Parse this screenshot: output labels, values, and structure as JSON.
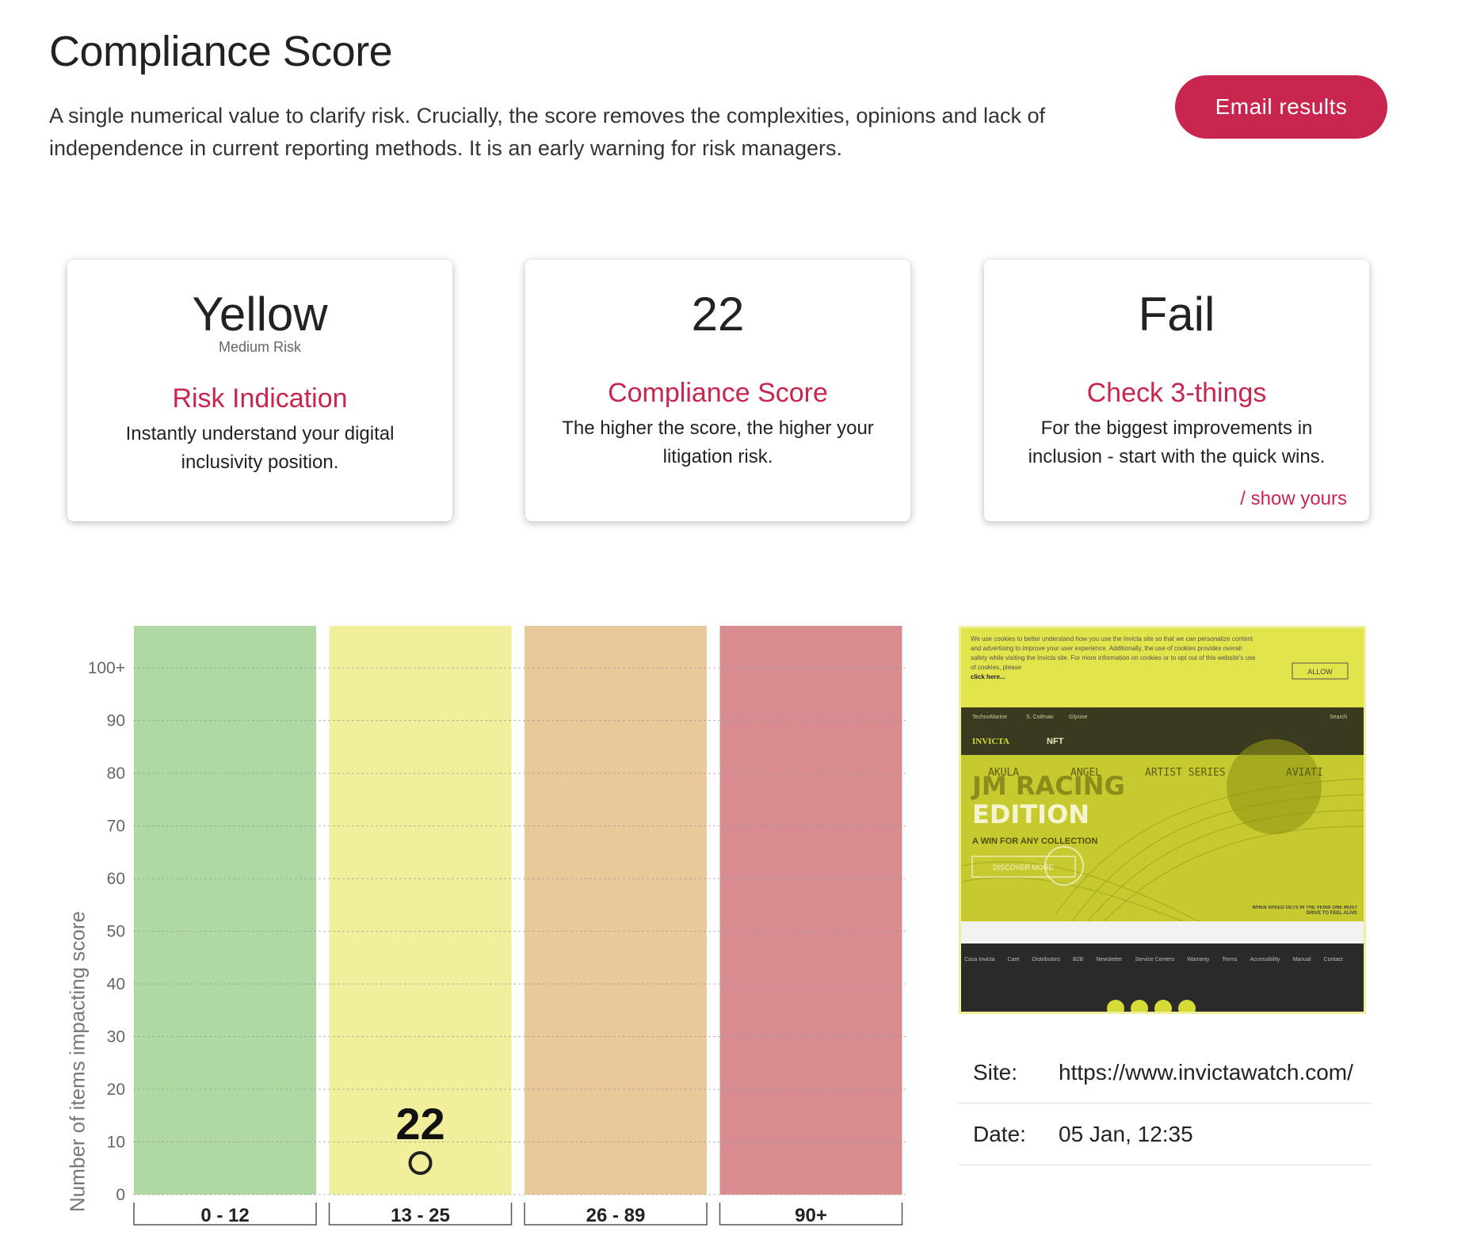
{
  "header": {
    "title": "Compliance Score",
    "description": "A single numerical value to clarify risk. Crucially, the score removes the complexities, opinions and lack of independence in current reporting methods. It is an early warning for risk managers.",
    "email_button": "Email results"
  },
  "cards": [
    {
      "big": "Yellow",
      "sub": "Medium Risk",
      "heading": "Risk Indication",
      "body": "Instantly understand your digital inclusivity position."
    },
    {
      "big": "22",
      "heading": "Compliance Score",
      "body": "The higher the score, the higher your litigation risk."
    },
    {
      "big": "Fail",
      "heading": "Check 3-things",
      "body": "For the biggest improvements in inclusion - start with the quick wins.",
      "link": "/ show yours"
    }
  ],
  "chart_data": {
    "type": "bar",
    "ylabel": "Number of items impacting score",
    "y_ticks": [
      "0",
      "10",
      "20",
      "30",
      "40",
      "50",
      "60",
      "70",
      "80",
      "90",
      "100+"
    ],
    "ylim": [
      0,
      108
    ],
    "categories": [
      "0 - 12",
      "13 - 25",
      "26 - 89",
      "90+"
    ],
    "band_colors": [
      "#afd8a3",
      "#f1ef9b",
      "#e9c99a",
      "#d98c90"
    ],
    "marker": {
      "category": "13 - 25",
      "label": "22",
      "y": 6
    },
    "grid": true
  },
  "screenshot_preview": {
    "cookie_text": "We use cookies to better understand how you use the Invicta site so that we can personalize content and advertising to improve your user experience. Additionally, the use of cookies provides overall safety while visiting the Invicta site. For more information on cookies or to opt out of this website's use of cookies, please",
    "cookie_link": "click here...",
    "allow": "ALLOW",
    "topbar_links": [
      "TechnoMarine",
      "S. Coifman",
      "Glycine"
    ],
    "search": "Search",
    "brand": "INVICTA",
    "nft": "NFT",
    "hero_line1": "JM RACING",
    "hero_line2": "EDITION",
    "hero_tagline": "A WIN FOR ANY COLLECTION",
    "discover": "DISCOVER MORE",
    "nav_items": [
      "AKULA",
      "ANGEL",
      "ARTIST SERIES",
      "AVIATI"
    ],
    "slogan": "WHEN SPEED GETS IN THE VEINS ONE MUST DRIVE TO FEEL ALIVE",
    "footer_links": [
      "Casa Invicta",
      "Care",
      "Distributors",
      "B2B",
      "Newsletter",
      "Service Centers",
      "Warranty",
      "Terms",
      "Accessibility",
      "Manual",
      "Contact"
    ]
  },
  "info": {
    "site_label": "Site:",
    "site_value": "https://www.invictawatch.com/",
    "date_label": "Date:",
    "date_value": "05 Jan, 12:35"
  }
}
